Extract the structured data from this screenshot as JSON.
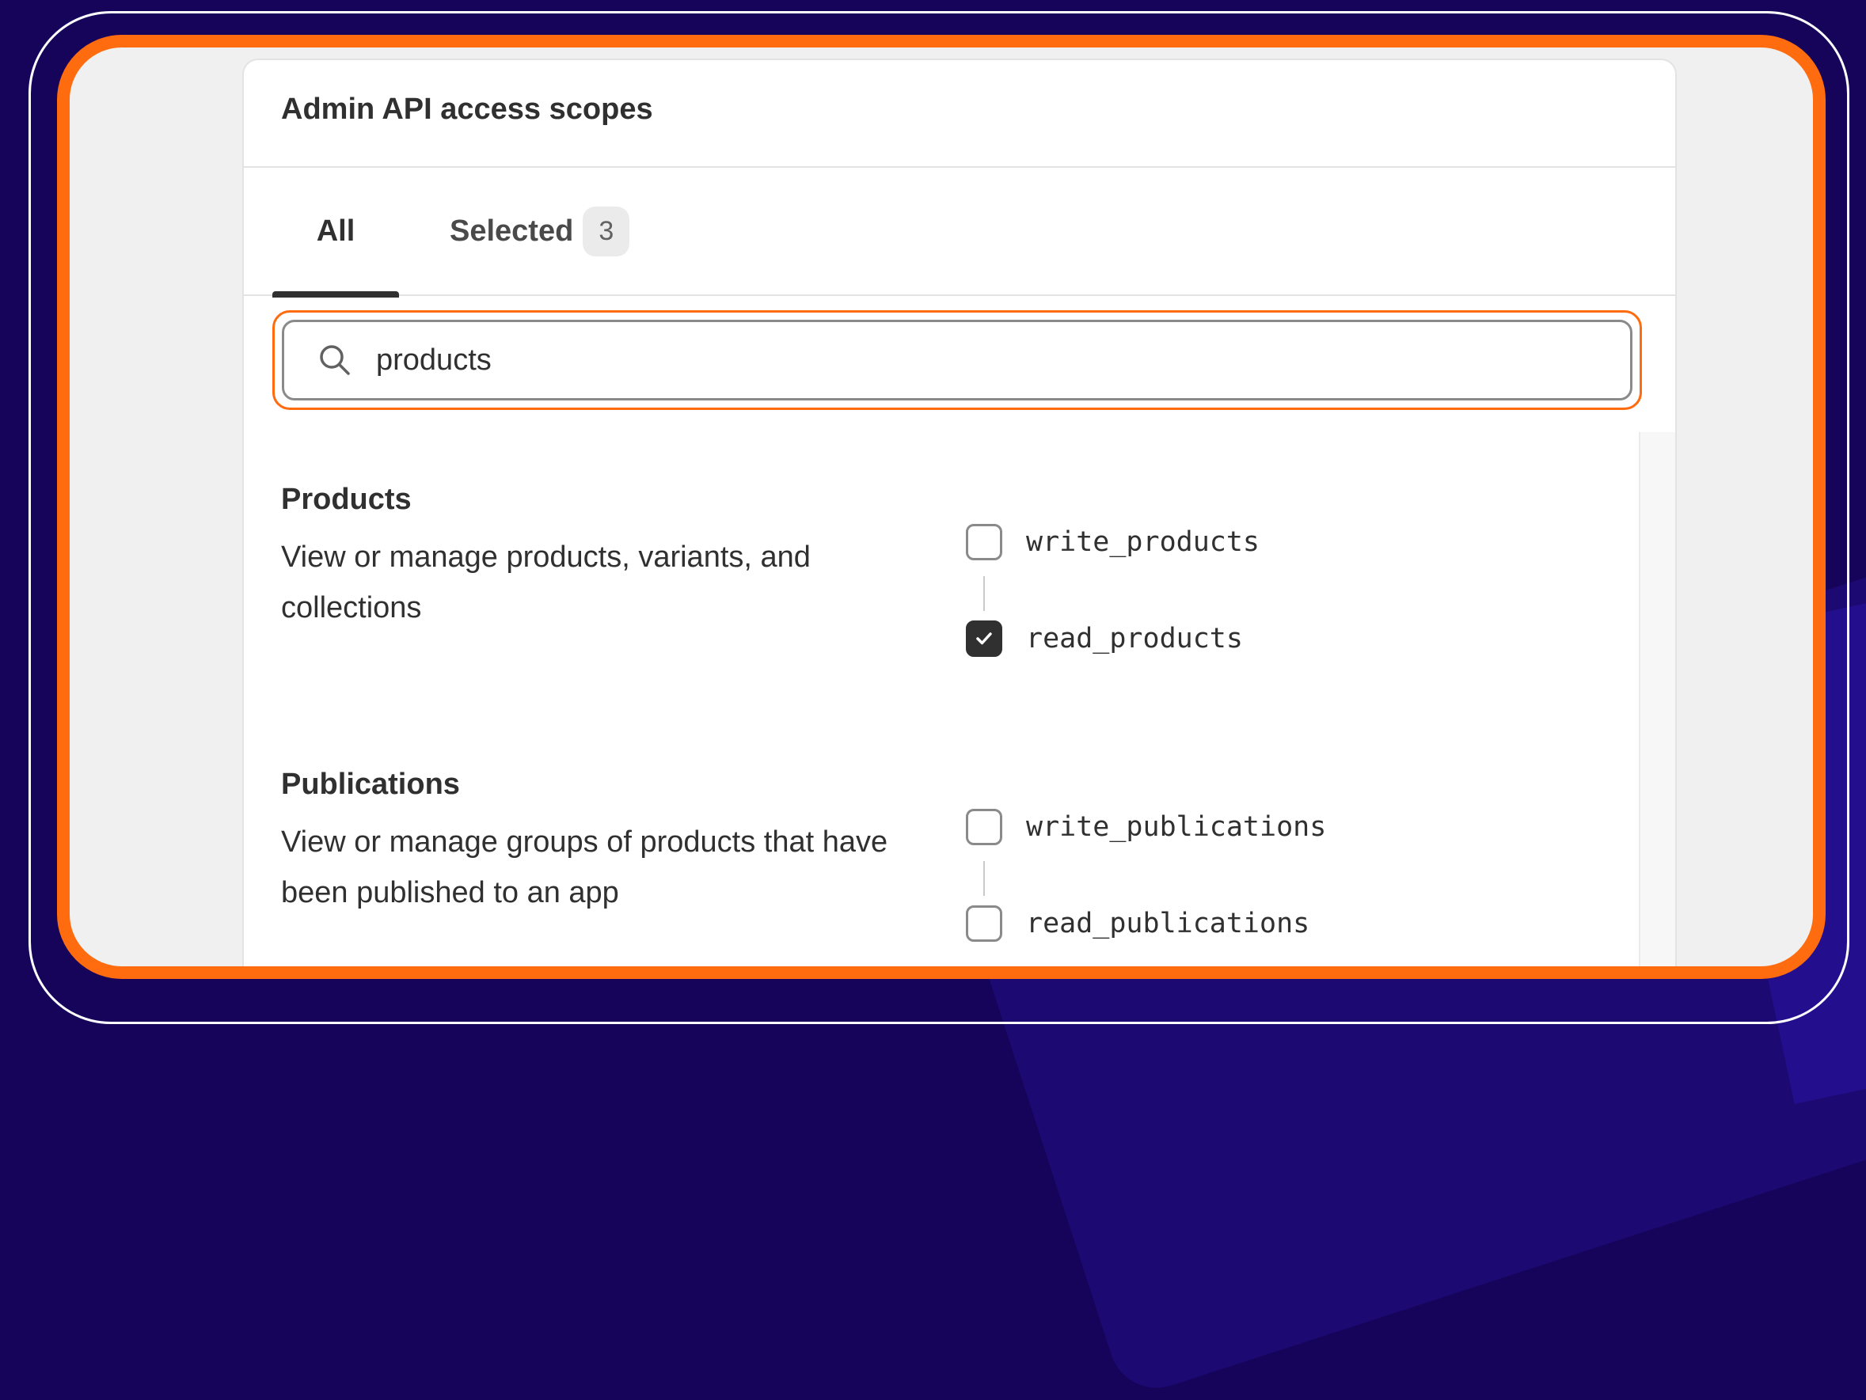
{
  "card": {
    "title": "Admin API access scopes"
  },
  "tabs": {
    "all_label": "All",
    "selected_label": "Selected",
    "selected_count": "3"
  },
  "search": {
    "value": "products"
  },
  "sections": [
    {
      "title": "Products",
      "description": "View or manage products, variants, and collections",
      "scopes": [
        {
          "label": "write_products",
          "checked": false
        },
        {
          "label": "read_products",
          "checked": true
        }
      ]
    },
    {
      "title": "Publications",
      "description": "View or manage groups of products that have been published to an app",
      "scopes": [
        {
          "label": "write_publications",
          "checked": false
        },
        {
          "label": "read_publications",
          "checked": false
        }
      ]
    }
  ],
  "colors": {
    "highlight": "#ff6b0f",
    "background": "#16045a",
    "checked": "#303030"
  }
}
